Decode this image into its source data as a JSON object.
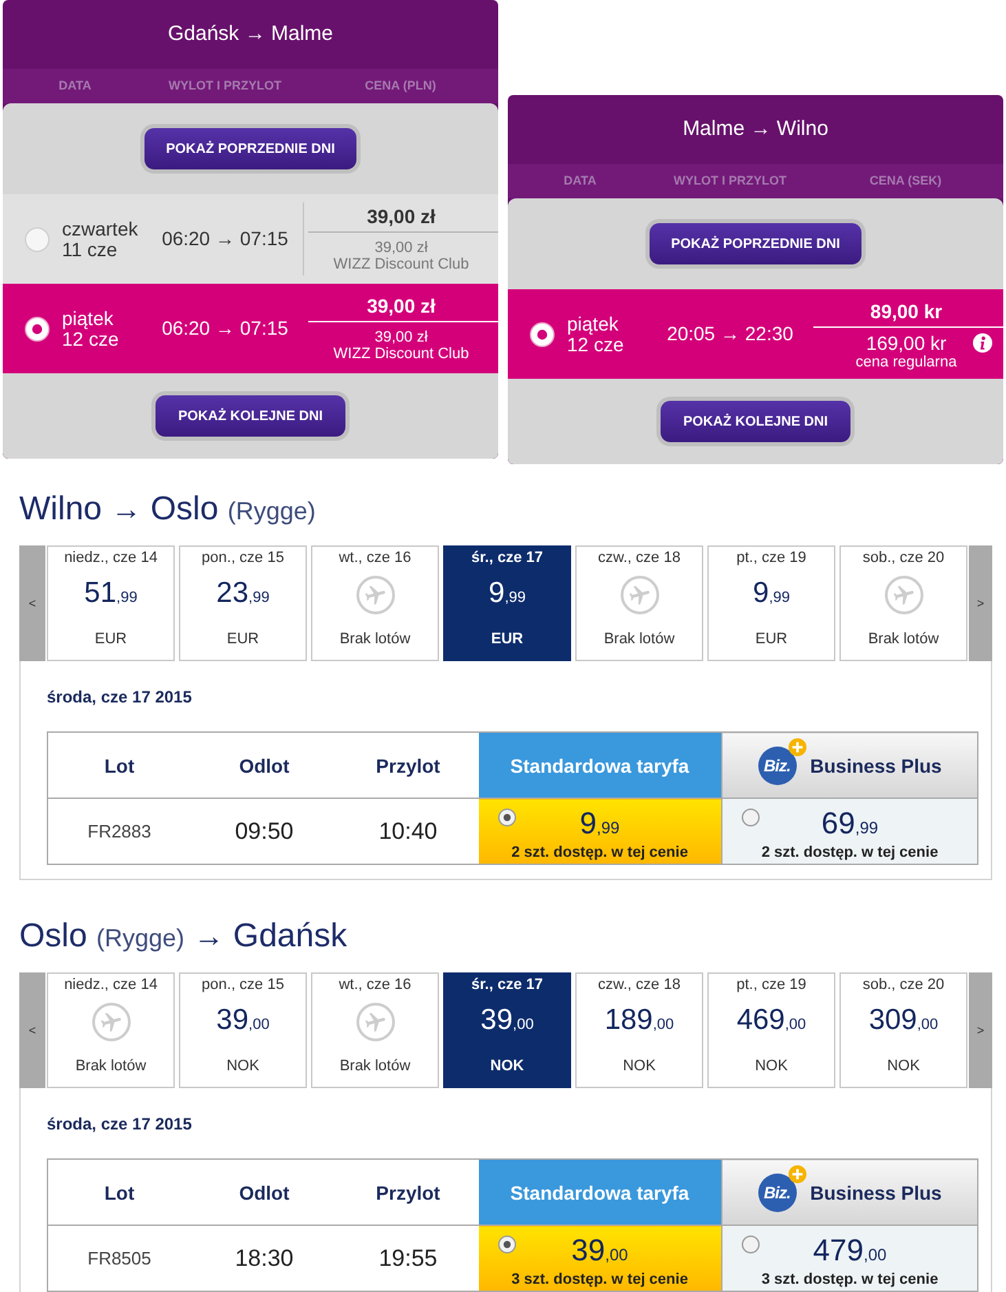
{
  "wizz_panels": [
    {
      "title": "Gdańsk → Malme",
      "columns": [
        "DATA",
        "WYLOT I PRZYLOT",
        "CENA (PLN)"
      ],
      "prev_button": "POKAŻ POPRZEDNIE DNI",
      "flights": [
        {
          "day": "czwartek",
          "date": "11 cze",
          "times": "06:20 → 07:15",
          "price": "39,00 zł",
          "secondary_price": "39,00 zł",
          "secondary_label": "WIZZ Discount Club",
          "kind": "club",
          "info_icon": false,
          "selected": false
        },
        {
          "day": "piątek",
          "date": "12 cze",
          "times": "06:20 → 07:15",
          "price": "39,00 zł",
          "secondary_price": "39,00 zł",
          "secondary_label": "WIZZ Discount Club",
          "kind": "club",
          "info_icon": false,
          "selected": true
        }
      ],
      "next_button": "POKAŻ KOLEJNE DNI"
    },
    {
      "title": "Malme → Wilno",
      "columns": [
        "DATA",
        "WYLOT I PRZYLOT",
        "CENA (SEK)"
      ],
      "prev_button": "POKAŻ POPRZEDNIE DNI",
      "flights": [
        {
          "day": "piątek",
          "date": "12 cze",
          "times": "20:05 → 22:30",
          "price": "89,00 kr",
          "secondary_price": "169,00 kr",
          "secondary_label": "cena regularna",
          "kind": "regular",
          "info_icon": true,
          "selected": true
        }
      ],
      "next_button": "POKAŻ KOLEJNE DNI"
    }
  ],
  "fare_sections": [
    {
      "title": [
        {
          "kind": "city",
          "text": "Wilno"
        },
        {
          "kind": "arrow",
          "text": "→"
        },
        {
          "kind": "city",
          "text": "Oslo"
        },
        {
          "kind": "airport",
          "text": "(Rygge)"
        }
      ],
      "prev_arrow": "<",
      "next_arrow": ">",
      "days": [
        {
          "kind": "fare",
          "date": "niedz., cze 14",
          "amount": "51",
          "decimals": ",99",
          "currency": "EUR",
          "selected": false
        },
        {
          "kind": "fare",
          "date": "pon., cze 15",
          "amount": "23",
          "decimals": ",99",
          "currency": "EUR",
          "selected": false
        },
        {
          "kind": "no_flights",
          "date": "wt., cze 16",
          "label": "Brak lotów",
          "selected": false
        },
        {
          "kind": "fare",
          "date": "śr., cze 17",
          "amount": "9",
          "decimals": ",99",
          "currency": "EUR",
          "selected": true
        },
        {
          "kind": "no_flights",
          "date": "czw., cze 18",
          "label": "Brak lotów",
          "selected": false
        },
        {
          "kind": "fare",
          "date": "pt., cze 19",
          "amount": "9",
          "decimals": ",99",
          "currency": "EUR",
          "selected": false
        },
        {
          "kind": "no_flights",
          "date": "sob., cze 20",
          "label": "Brak lotów",
          "selected": false
        }
      ],
      "date_heading": "środa, cze 17 2015",
      "columns": [
        {
          "kind": "plain",
          "label": "Lot"
        },
        {
          "kind": "plain",
          "label": "Odlot"
        },
        {
          "kind": "plain",
          "label": "Przylot"
        },
        {
          "kind": "standard",
          "label": "Standardowa taryfa"
        },
        {
          "kind": "business",
          "label": "Business Plus",
          "logo_text": "Biz."
        }
      ],
      "rows": [
        {
          "flight": "FR2883",
          "departure": "09:50",
          "arrival": "10:40",
          "fares": [
            {
              "amount": "9",
              "decimals": ",99",
              "availability": "2 szt. dostęp. w tej cenie",
              "selected": true
            },
            {
              "amount": "69",
              "decimals": ",99",
              "availability": "2 szt. dostęp. w tej cenie",
              "selected": false
            }
          ]
        }
      ]
    },
    {
      "title": [
        {
          "kind": "city",
          "text": "Oslo"
        },
        {
          "kind": "airport",
          "text": "(Rygge)"
        },
        {
          "kind": "arrow",
          "text": "→"
        },
        {
          "kind": "city",
          "text": "Gdańsk"
        }
      ],
      "prev_arrow": "<",
      "next_arrow": ">",
      "days": [
        {
          "kind": "no_flights",
          "date": "niedz., cze 14",
          "label": "Brak lotów",
          "selected": false
        },
        {
          "kind": "fare",
          "date": "pon., cze 15",
          "amount": "39",
          "decimals": ",00",
          "currency": "NOK",
          "selected": false
        },
        {
          "kind": "no_flights",
          "date": "wt., cze 16",
          "label": "Brak lotów",
          "selected": false
        },
        {
          "kind": "fare",
          "date": "śr., cze 17",
          "amount": "39",
          "decimals": ",00",
          "currency": "NOK",
          "selected": true
        },
        {
          "kind": "fare",
          "date": "czw., cze 18",
          "amount": "189",
          "decimals": ",00",
          "currency": "NOK",
          "selected": false
        },
        {
          "kind": "fare",
          "date": "pt., cze 19",
          "amount": "469",
          "decimals": ",00",
          "currency": "NOK",
          "selected": false
        },
        {
          "kind": "fare",
          "date": "sob., cze 20",
          "amount": "309",
          "decimals": ",00",
          "currency": "NOK",
          "selected": false
        }
      ],
      "date_heading": "środa, cze 17 2015",
      "columns": [
        {
          "kind": "plain",
          "label": "Lot"
        },
        {
          "kind": "plain",
          "label": "Odlot"
        },
        {
          "kind": "plain",
          "label": "Przylot"
        },
        {
          "kind": "standard",
          "label": "Standardowa taryfa"
        },
        {
          "kind": "business",
          "label": "Business Plus",
          "logo_text": "Biz."
        }
      ],
      "rows": [
        {
          "flight": "FR8505",
          "departure": "18:30",
          "arrival": "19:55",
          "fares": [
            {
              "amount": "39",
              "decimals": ",00",
              "availability": "3 szt. dostęp. w tej cenie",
              "selected": true
            },
            {
              "amount": "479",
              "decimals": ",00",
              "availability": "3 szt. dostęp. w tej cenie",
              "selected": false
            }
          ]
        }
      ]
    }
  ]
}
